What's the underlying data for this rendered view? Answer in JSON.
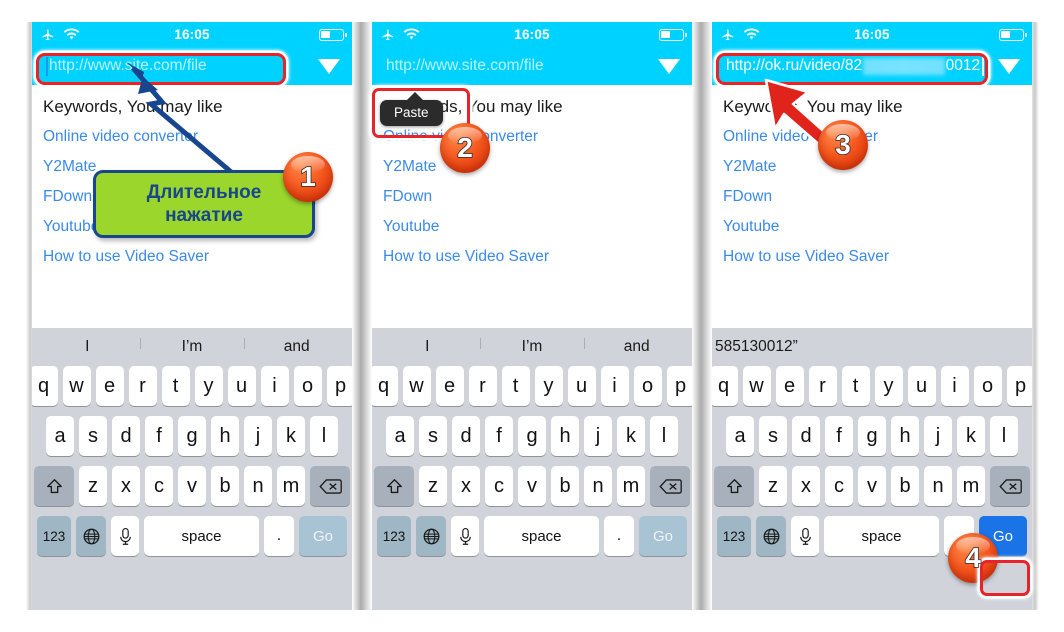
{
  "status_bar": {
    "airplane_icon": "airplane-icon",
    "wifi_icon": "wifi-icon",
    "time": "16:05",
    "battery_icon": "battery-icon"
  },
  "panels": [
    {
      "id": "panel-1",
      "url_value": "http://www.site.com/file",
      "url_is_placeholder": true,
      "url_highlighted": true,
      "dropdown_icon": "chevron-down-icon",
      "list_title": "Keywords, You may like",
      "links": [
        "Online video converter",
        "Y2Mate",
        "FDown",
        "Youtube",
        "How to use Video Saver"
      ],
      "predictions": [
        "I",
        "I’m",
        "and"
      ],
      "go_label": "Go",
      "go_active": false,
      "callout_text": "Длительное нажатие",
      "badge": "1"
    },
    {
      "id": "panel-2",
      "url_value": "http://www.site.com/file",
      "url_is_placeholder": true,
      "url_highlighted": false,
      "dropdown_icon": "chevron-down-icon",
      "list_title": "Keywords, You may like",
      "links": [
        "Online video converter",
        "Y2Mate",
        "FDown",
        "Youtube",
        "How to use Video Saver"
      ],
      "predictions": [
        "I",
        "I’m",
        "and"
      ],
      "go_label": "Go",
      "go_active": false,
      "paste_label": "Paste",
      "badge": "2"
    },
    {
      "id": "panel-3",
      "url_prefix": "http://ok.ru/video/82",
      "url_suffix": "0012",
      "url_is_placeholder": false,
      "url_highlighted": true,
      "dropdown_icon": "chevron-down-icon",
      "list_title": "Keywords, You may like",
      "links": [
        "Online video converter",
        "Y2Mate",
        "FDown",
        "Youtube",
        "How to use Video Saver"
      ],
      "predictions": [
        "585130012”",
        "",
        ""
      ],
      "go_label": "Go",
      "go_active": true,
      "badge_url": "3",
      "badge_go": "4"
    }
  ],
  "keyboard": {
    "row1": [
      "q",
      "w",
      "e",
      "r",
      "t",
      "y",
      "u",
      "i",
      "o",
      "p"
    ],
    "row2": [
      "a",
      "s",
      "d",
      "f",
      "g",
      "h",
      "j",
      "k",
      "l"
    ],
    "row3": [
      "z",
      "x",
      "c",
      "v",
      "b",
      "n",
      "m"
    ],
    "shift_icon": "shift-up-arrow-icon",
    "backspace_icon": "backspace-delete-icon",
    "numbers_label": "123",
    "globe_icon": "globe-language-icon",
    "mic_icon": "microphone-icon",
    "space_label": "space",
    "period_label": "."
  },
  "colors": {
    "accent_cyan": "#00d2ff",
    "link_blue": "#3b8ae8",
    "highlight_red": "#e8242a",
    "callout_green": "#9ad62c",
    "callout_border_blue": "#17468e",
    "badge_orange": "#f4571e",
    "keyboard_bg": "#d0d4da",
    "go_active_blue": "#1a74e8"
  }
}
